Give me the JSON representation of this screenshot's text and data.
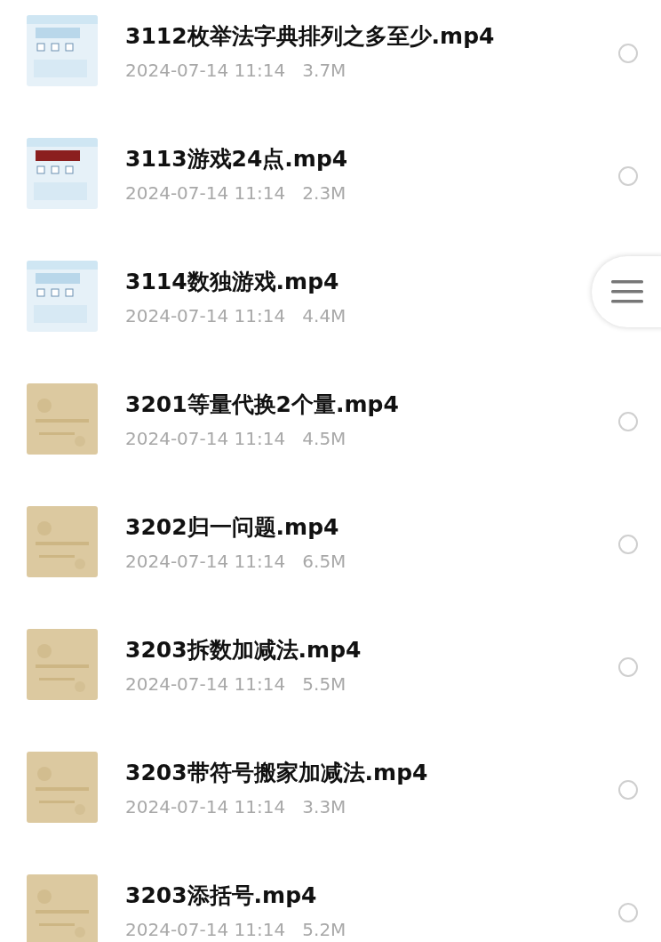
{
  "files": [
    {
      "name": "3112枚举法字典排列之多至少.mp4",
      "meta": "2024-07-14 11:14   3.7M",
      "selected": false
    },
    {
      "name": "3113游戏24点.mp4",
      "meta": "2024-07-14 11:14   2.3M",
      "selected": false
    },
    {
      "name": "3114数独游戏.mp4",
      "meta": "2024-07-14 11:14   4.4M"
    },
    {
      "name": "3201等量代换2个量.mp4",
      "meta": "2024-07-14 11:14   4.5M",
      "selected": false
    },
    {
      "name": "3202归一问题.mp4",
      "meta": "2024-07-14 11:14   6.5M",
      "selected": false
    },
    {
      "name": "3203拆数加减法.mp4",
      "meta": "2024-07-14 11:14   5.5M",
      "selected": false
    },
    {
      "name": "3203带符号搬家加减法.mp4",
      "meta": "2024-07-14 11:14   3.3M",
      "selected": false
    },
    {
      "name": "3203添括号.mp4",
      "meta": "2024-07-14 11:14   5.2M",
      "selected": false
    }
  ]
}
